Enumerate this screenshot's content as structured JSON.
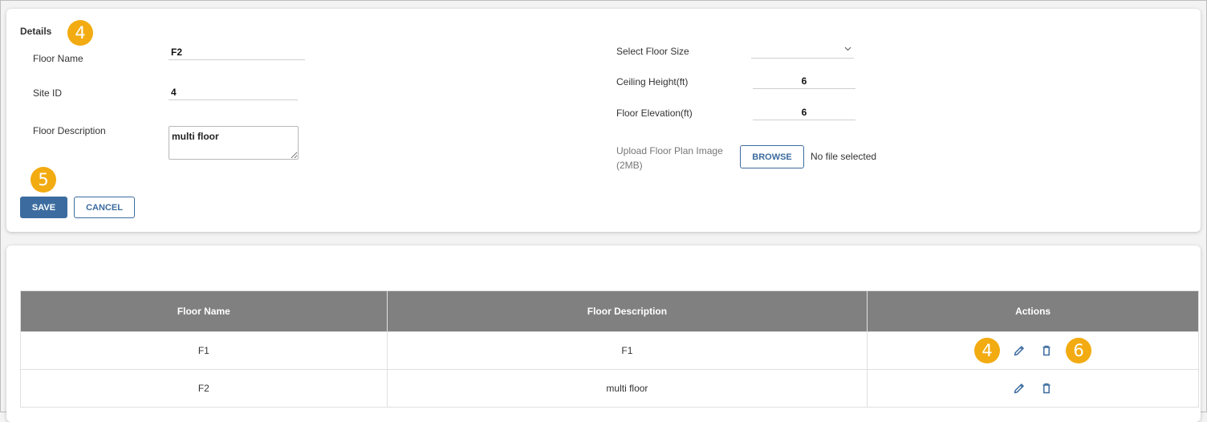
{
  "details": {
    "title": "Details",
    "floor_name_label": "Floor Name",
    "floor_name_value": "F2",
    "site_id_label": "Site ID",
    "site_id_value": "4",
    "floor_description_label": "Floor Description",
    "floor_description_value": "multi floor",
    "floor_size_label": "Select Floor Size",
    "floor_size_value": "",
    "ceiling_height_label": "Ceiling Height(ft)",
    "ceiling_height_value": "6",
    "floor_elevation_label": "Floor Elevation(ft)",
    "floor_elevation_value": "6",
    "upload_label_line1": "Upload Floor Plan Image",
    "upload_label_line2": "(2MB)",
    "browse_label": "BROWSE",
    "file_status": "No file selected",
    "save_label": "SAVE",
    "cancel_label": "CANCEL"
  },
  "badges": {
    "details": "4",
    "save": "5",
    "edit": "4",
    "delete": "6"
  },
  "table": {
    "columns": [
      "Floor Name",
      "Floor Description",
      "Actions"
    ],
    "rows": [
      {
        "floor_name": "F1",
        "floor_description": "F1"
      },
      {
        "floor_name": "F2",
        "floor_description": "multi floor"
      }
    ]
  },
  "colors": {
    "accent": "#3c6c9f",
    "badge": "#f2ab10",
    "table_header": "#808080"
  },
  "icons": {
    "edit": "pencil-icon",
    "delete": "trash-icon",
    "dropdown": "chevron-down-icon"
  }
}
